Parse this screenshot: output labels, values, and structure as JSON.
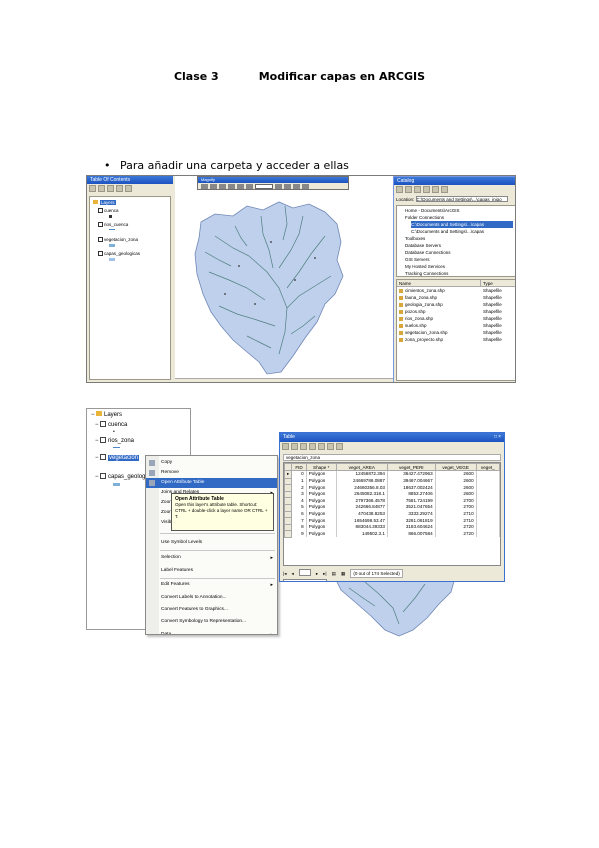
{
  "document": {
    "title_part1": "Clase 3",
    "title_part2": "Modificar capas en ARCGIS",
    "bullet_text": "Para añadir una carpeta y acceder a ellas"
  },
  "screenshot1": {
    "toc_title": "Table Of Contents",
    "toc_layers_label": "Layers",
    "toc_items": [
      "cuenca",
      "rios_cuenca",
      "vegetacion_zona",
      "capas_geologicas"
    ],
    "map_title": "Magnify",
    "catalog_title": "Catalog",
    "catalog_location_label": "Location:",
    "catalog_location_value": "C:\\Documents and Settings\\...\\capas_inigo",
    "catalog_tree": [
      "Home - Documents\\ArcGIS",
      "Folder Connections",
      "C:\\Documents and Settings\\...\\capas",
      "C:\\Documents and Settings\\...\\capas",
      "Toolboxes",
      "Database Servers",
      "Database Connections",
      "GIS Servers",
      "My Hosted Services",
      "Tracking Connections"
    ],
    "catalog_list_header_name": "Name",
    "catalog_list_header_type": "Type",
    "catalog_files": [
      {
        "name": "cimientos_zona.shp",
        "type": "Shapefile"
      },
      {
        "name": "fauna_zona.shp",
        "type": "Shapefile"
      },
      {
        "name": "geologia_zona.shp",
        "type": "Shapefile"
      },
      {
        "name": "pozos.shp",
        "type": "Shapefile"
      },
      {
        "name": "rios_zona.shp",
        "type": "Shapefile"
      },
      {
        "name": "suelos.shp",
        "type": "Shapefile"
      },
      {
        "name": "vegetacion_zona.shp",
        "type": "Shapefile"
      },
      {
        "name": "zona_proyecto.shp",
        "type": "Shapefile"
      }
    ]
  },
  "screenshot2": {
    "toc_layers_label": "Layers",
    "toc_items": [
      "cuenca",
      "rios_zona",
      "vegetacion",
      "capas_geologicas"
    ],
    "context_menu": [
      {
        "label": "Copy",
        "y": 0
      },
      {
        "label": "Remove",
        "y": 1
      },
      {
        "label": "Open Attribute Table",
        "y": 2,
        "highlight": true
      },
      {
        "label": "Joins and Relates",
        "y": 3,
        "submenu": true
      },
      {
        "label": "Zoom To Layer",
        "y": 4
      },
      {
        "label": "Zoom To Make Visible",
        "y": 5
      },
      {
        "label": "Visible Scale Range",
        "y": 6
      },
      {
        "label": "Use Symbol Levels",
        "y": 8
      },
      {
        "label": "Selection",
        "y": 9.5,
        "submenu": true
      },
      {
        "label": "Label Features",
        "y": 10.8
      },
      {
        "label": "Edit Features",
        "y": 12.2,
        "submenu": true
      },
      {
        "label": "Convert Labels to Annotation...",
        "y": 13.5
      },
      {
        "label": "Convert Features to Graphics...",
        "y": 14.7
      },
      {
        "label": "Convert Symbology to Representation...",
        "y": 15.9
      },
      {
        "label": "Data",
        "y": 17.2,
        "submenu": true
      }
    ],
    "tooltip": {
      "title": "Open Attribute Table",
      "body": "Open this layer's attribute table. Shortcut: CTRL + double-click a layer name OR CTRL + T."
    },
    "table": {
      "title": "Table",
      "tab_label": "vegetacion_zona",
      "columns": [
        "FID",
        "Shape *",
        "veget_AREA",
        "veget_PERI",
        "veget_VEGE",
        "veget_"
      ],
      "rows": [
        [
          "0",
          "Polygon",
          "12456872.394",
          "36427.472963",
          "2600"
        ],
        [
          "1",
          "Polygon",
          "24669786.0887",
          "39467.004667",
          "2600"
        ],
        [
          "2",
          "Polygon",
          "24660356.8.03",
          "18637.002424",
          "2600"
        ],
        [
          "3",
          "Polygon",
          "2645082.318.1",
          "8853.27406",
          "2600"
        ],
        [
          "4",
          "Polygon",
          "2797366.4578",
          "7581.724199",
          "2700"
        ],
        [
          "5",
          "Polygon",
          "242666.84877",
          "3521.047654",
          "2700"
        ],
        [
          "6",
          "Polygon",
          "470438.8253",
          "3333.29274",
          "2710"
        ],
        [
          "7",
          "Polygon",
          "1654698.53.47",
          "3261.061819",
          "2710"
        ],
        [
          "8",
          "Polygon",
          "883044.39333",
          "3183.604624",
          "2720"
        ],
        [
          "9",
          "Polygon",
          "149502.3.1",
          "866.007584",
          "2720"
        ]
      ],
      "record_label": "(0 out of 174 Selected)"
    }
  }
}
